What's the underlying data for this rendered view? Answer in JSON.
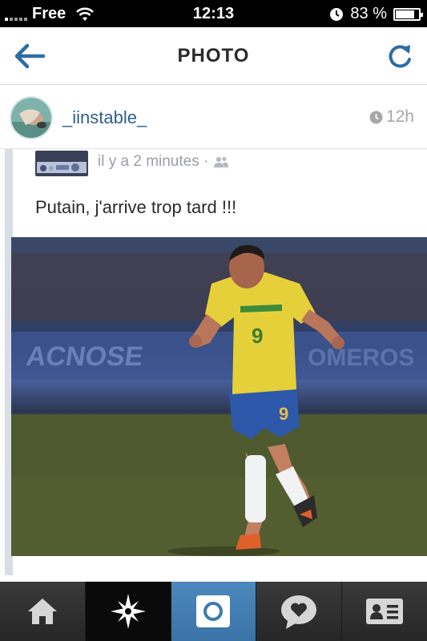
{
  "status_bar": {
    "carrier": "Free",
    "time": "12:13",
    "battery": "83 %",
    "battery_level": 0.83
  },
  "nav": {
    "title": "PHOTO",
    "back_icon": "back-arrow-icon",
    "refresh_icon": "refresh-icon"
  },
  "post": {
    "username": "_iinstable_",
    "time": "12h",
    "time_icon": "clock-icon"
  },
  "photo": {
    "fb_meta": "il y a 2 minutes ·",
    "fb_text": "Putain, j'arrive trop tard !!!",
    "player_number": "9"
  },
  "tabs": [
    {
      "icon": "home-icon"
    },
    {
      "icon": "explore-icon"
    },
    {
      "icon": "camera-icon"
    },
    {
      "icon": "activity-icon"
    },
    {
      "icon": "profile-icon"
    }
  ],
  "colors": {
    "accent": "#2d6da3",
    "username": "#2d5f8a",
    "camera_tab": "#3f7bb0"
  }
}
